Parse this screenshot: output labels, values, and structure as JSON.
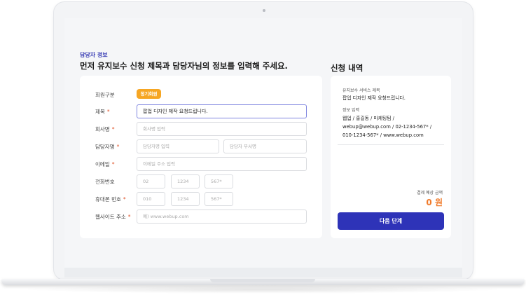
{
  "header": {
    "subtitle": "담당자 정보",
    "title": "먼저 유지보수 신청 제목과 담당자님의 정보를 입력해 주세요."
  },
  "form": {
    "member_type": {
      "label": "회원구분",
      "badge": "정기회원"
    },
    "subject": {
      "label": "제목",
      "required": "*",
      "value": "팝업 디자인 제작 요청드립니다."
    },
    "company": {
      "label": "회사명",
      "required": "*",
      "placeholder": "회사명 입력"
    },
    "manager": {
      "label": "담당자명",
      "required": "*",
      "name_placeholder": "담당자명 입력",
      "dept_placeholder": "담당자 부서명"
    },
    "email": {
      "label": "이메일",
      "required": "*",
      "placeholder": "이메일 주소 입력"
    },
    "phone": {
      "label": "전화번호",
      "p1": "02",
      "p2": "1234",
      "p3": "567*"
    },
    "mobile": {
      "label": "휴대폰 번호",
      "required": "*",
      "p1": "010",
      "p2": "1234",
      "p3": "567*"
    },
    "website": {
      "label": "웹사이트 주소",
      "required": "*",
      "placeholder": "예) www.webup.com"
    }
  },
  "summary": {
    "title": "신청 내역",
    "service_label": "유지보수 서비스 제목",
    "service_value": "팝업 디자인 제작 요청드립니다.",
    "info_label": "정보 입력",
    "info_lines": [
      "웹업 / 홍길동 / 마케팅팀 /",
      "webup@webup.com / 02-1234-567* /",
      "010-1234-567* / www.webup.com"
    ],
    "price_label": "결제 예상 금액",
    "price": "0 원",
    "next_button": "다음 단계"
  },
  "colors": {
    "accent": "#2e33b8",
    "badge": "#f6a623",
    "price": "#f07a2a",
    "required": "#e0542a"
  }
}
